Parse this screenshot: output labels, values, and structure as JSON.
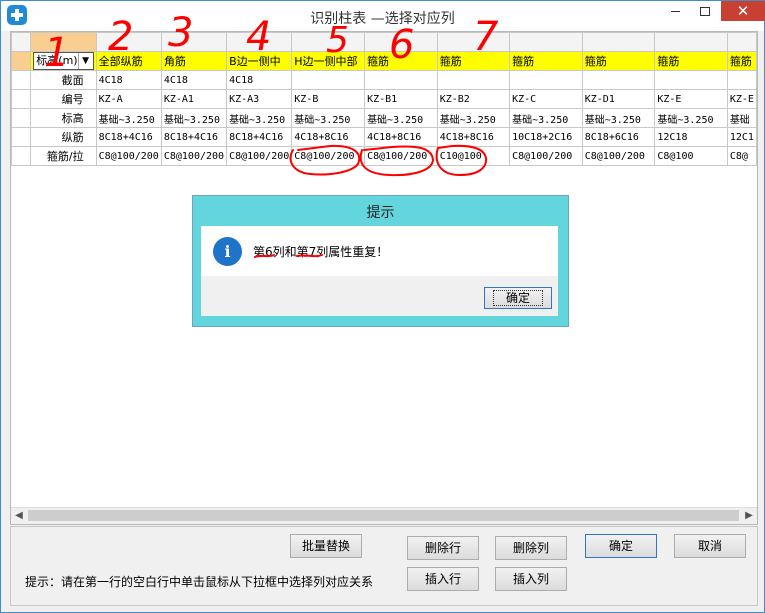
{
  "window": {
    "title": "识别柱表 —选择对应列"
  },
  "grid": {
    "mapping_row": [
      "标高(m)",
      "全部纵筋",
      "角筋",
      "B边一侧中",
      "H边一侧中部",
      "箍筋",
      "箍筋",
      "箍筋",
      "箍筋",
      "箍筋",
      "箍筋"
    ],
    "rows": [
      {
        "label": "截面",
        "cells": [
          "4C18",
          "4C18",
          "4C18",
          "",
          "",
          "",
          "",
          "",
          "",
          ""
        ]
      },
      {
        "label": "编号",
        "cells": [
          "KZ-A",
          "KZ-A1",
          "KZ-A3",
          "KZ-B",
          "KZ-B1",
          "KZ-B2",
          "KZ-C",
          "KZ-D1",
          "KZ-E",
          "KZ-E"
        ]
      },
      {
        "label": "标高",
        "cells": [
          "基础~3.250",
          "基础~3.250",
          "基础~3.250",
          "基础~3.250",
          "基础~3.250",
          "基础~3.250",
          "基础~3.250",
          "基础~3.250",
          "基础~3.250",
          "基础"
        ]
      },
      {
        "label": "纵筋",
        "cells": [
          "8C18+4C16",
          "8C18+4C16",
          "8C18+4C16",
          "4C18+8C16",
          "4C18+8C16",
          "4C18+8C16",
          "10C18+2C16",
          "8C18+6C16",
          "12C18",
          "12C1"
        ]
      },
      {
        "label": "箍筋/拉",
        "cells": [
          "C8@100/200",
          "C8@100/200",
          "C8@100/200",
          "C8@100/200",
          "C8@100/200",
          "C10@100",
          "C8@100/200",
          "C8@100/200",
          "C8@100",
          "C8@"
        ]
      }
    ],
    "annotations": [
      "1",
      "2",
      "3",
      "4",
      "5",
      "6",
      "7"
    ]
  },
  "buttons": {
    "batch_replace": "批量替换",
    "delete_row": "删除行",
    "delete_col": "删除列",
    "ok": "确定",
    "cancel": "取消",
    "insert_row": "插入行",
    "insert_col": "插入列"
  },
  "hint": "提示：请在第一行的空白行中单击鼠标从下拉框中选择列对应关系",
  "dialog": {
    "title": "提示",
    "message": "第6列和第7列属性重复！",
    "ok": "确定",
    "icon": "info-icon"
  },
  "colors": {
    "mapping_row": "#fefe00",
    "selected_cell": "#f8cf91",
    "dialog_title": "#62d5dd",
    "annotation": "#ff0000",
    "close_button": "#c84031"
  }
}
